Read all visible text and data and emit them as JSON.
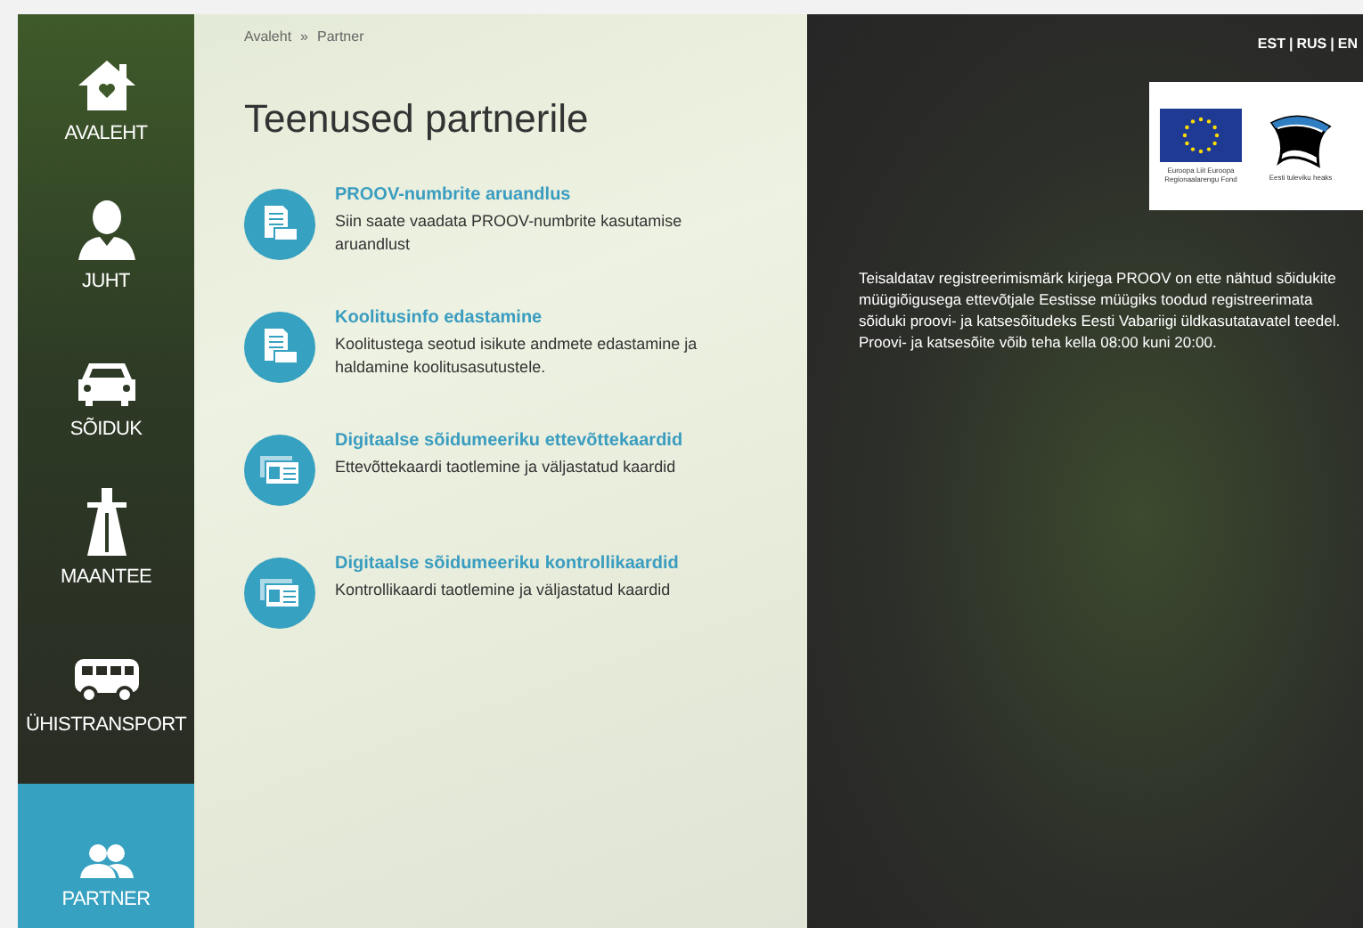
{
  "sidebar": {
    "items": [
      {
        "label": "AVALEHT",
        "kind": "home",
        "selected": false
      },
      {
        "label": "JUHT",
        "kind": "person",
        "selected": false
      },
      {
        "label": "SÕIDUK",
        "kind": "car",
        "selected": false
      },
      {
        "label": "MAANTEE",
        "kind": "road",
        "selected": false
      },
      {
        "label": "ÜHISTRANSPORT",
        "kind": "bus",
        "selected": false
      },
      {
        "label": "PARTNER",
        "kind": "people",
        "selected": true
      }
    ]
  },
  "breadcrumb": {
    "items": [
      "Avaleht",
      "Partner"
    ],
    "separator": "»"
  },
  "title": "Teenused partnerile",
  "services": [
    {
      "title": "PROOV-numbrite aruandlus",
      "description": "Siin saate vaadata PROOV-numbrite kasutamise aruandlust",
      "kind": "document"
    },
    {
      "title": "Koolitusinfo edastamine",
      "description": "Koolitustega seotud isikute andmete edastamine ja haldamine koolitusasutustele.",
      "kind": "document"
    },
    {
      "title": "Digitaalse sõidumeeriku ettevõttekaardid",
      "description": "Ettevõttekaardi taotlemine ja väljastatud kaardid",
      "kind": "card"
    },
    {
      "title": "Digitaalse sõidumeeriku kontrollikaardid",
      "description": "Kontrollikaardi taotlemine ja väljastatud kaardid",
      "kind": "card"
    }
  ],
  "languages": {
    "items": [
      "EST",
      "RUS",
      "EN"
    ],
    "separator": "|"
  },
  "logos": {
    "eu_caption": "Euroopa Liit Euroopa Regionaalarengu Fond",
    "ee_caption": "Eesti tuleviku heaks"
  },
  "info_text": "Teisaldatav registreerimismärk kirjega PROOV on ette nähtud sõidukite müügiõigusega ettevõtjale Eestisse müügiks toodud registreerimata sõiduki proovi- ja katsesõitudeks Eesti Vabariigi üldkasutatavatel teedel. Proovi- ja katsesõite võib teha kella 08:00 kuni 20:00."
}
